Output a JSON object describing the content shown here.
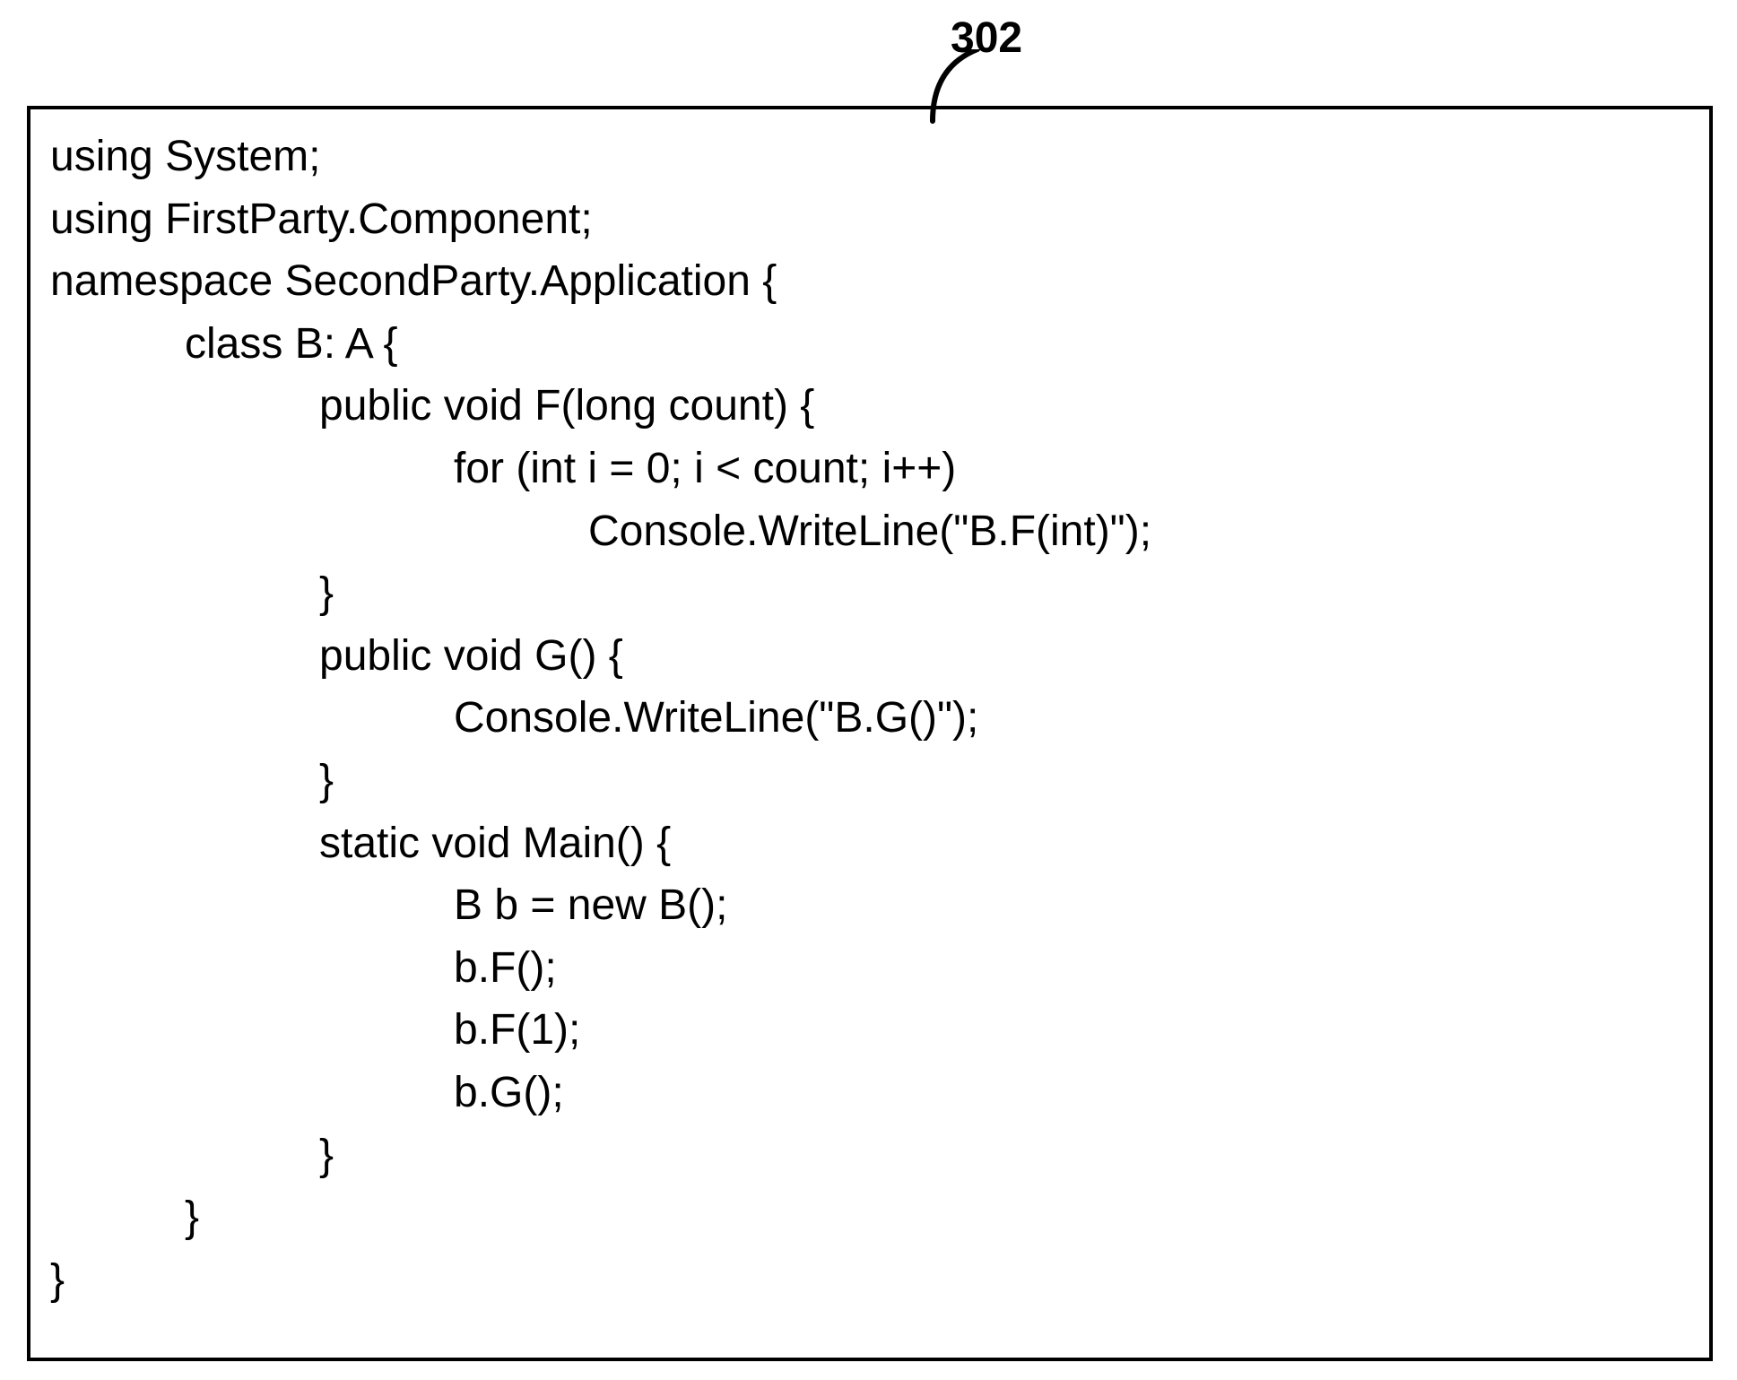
{
  "callout": {
    "label": "302"
  },
  "code": {
    "lines": [
      {
        "text": "using System;",
        "indent": 0
      },
      {
        "text": "using FirstParty.Component;",
        "indent": 0
      },
      {
        "text": "namespace SecondParty.Application {",
        "indent": 0
      },
      {
        "text": "class B: A {",
        "indent": 1
      },
      {
        "text": "public void F(long count) {",
        "indent": 2
      },
      {
        "text": "for (int i = 0; i < count; i++)",
        "indent": 3
      },
      {
        "text": "Console.WriteLine(\"B.F(int)\");",
        "indent": 4
      },
      {
        "text": "}",
        "indent": 2
      },
      {
        "text": "public void G() {",
        "indent": 2
      },
      {
        "text": "Console.WriteLine(\"B.G()\");",
        "indent": 3
      },
      {
        "text": "}",
        "indent": 2
      },
      {
        "text": "static void Main() {",
        "indent": 2
      },
      {
        "text": "B b = new B();",
        "indent": 3
      },
      {
        "text": "b.F();",
        "indent": 3
      },
      {
        "text": "b.F(1);",
        "indent": 3
      },
      {
        "text": "b.G();",
        "indent": 3
      },
      {
        "text": "}",
        "indent": 2
      },
      {
        "text": "}",
        "indent": 1
      },
      {
        "text": "}",
        "indent": 0
      }
    ]
  }
}
